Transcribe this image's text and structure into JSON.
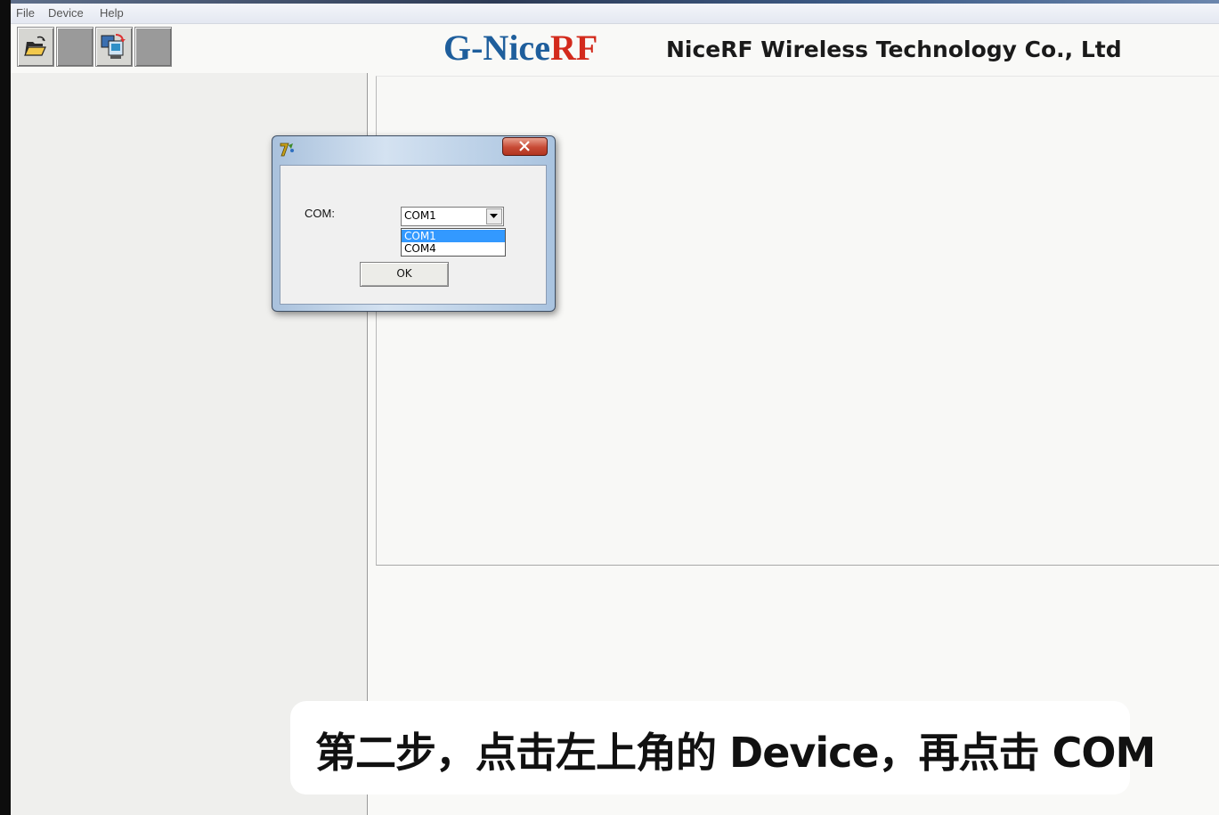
{
  "menu": {
    "file": "File",
    "device": "Device",
    "help": "Help"
  },
  "toolbar": {
    "buttons": [
      {
        "icon": "open-folder-icon"
      },
      {
        "icon": "blank-gray-icon"
      },
      {
        "icon": "device-config-icon"
      },
      {
        "icon": "blank-gray-icon"
      }
    ]
  },
  "header": {
    "brand_prefix": "G-Nice",
    "brand_suffix": "RF",
    "company": "NiceRF Wireless Technology Co., Ltd",
    "brand_colors": {
      "blue": "#1e5e9c",
      "red": "#d32a1c"
    }
  },
  "dialog": {
    "label": "COM:",
    "selected": "COM1",
    "options": [
      "COM1",
      "COM4"
    ],
    "ok_label": "OK",
    "highlight_color": "#3399ff"
  },
  "caption": {
    "text": "第二步，点击左上角的 Device，再点击 COM"
  }
}
